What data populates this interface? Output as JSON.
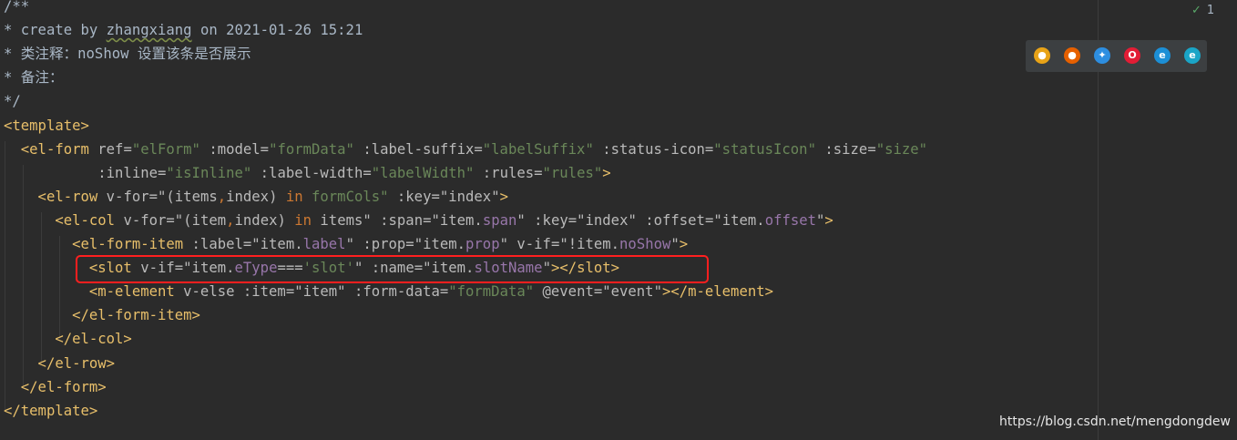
{
  "editor": {
    "lines": [
      [
        {
          "t": "/**",
          "c": "cm"
        }
      ],
      [
        {
          "t": "* create by ",
          "c": "cm"
        },
        {
          "t": "zhangxiang",
          "c": "cm cm-u"
        },
        {
          "t": " on 2021-01-26 15:21",
          "c": "cm"
        }
      ],
      [
        {
          "t": "* 类注释：noShow 设置该条是否展示",
          "c": "cm"
        }
      ],
      [
        {
          "t": "* 备注：",
          "c": "cm"
        }
      ],
      [
        {
          "t": "*/",
          "c": "cm"
        }
      ],
      [
        {
          "t": "<template>",
          "c": "tg"
        }
      ],
      [
        {
          "t": "  <el-form",
          "c": "tg"
        },
        {
          "t": " ref",
          "c": "at"
        },
        {
          "t": "=",
          "c": "at"
        },
        {
          "t": "\"elForm\"",
          "c": "st"
        },
        {
          "t": " :model",
          "c": "at"
        },
        {
          "t": "=",
          "c": "at"
        },
        {
          "t": "\"formData\"",
          "c": "st"
        },
        {
          "t": " :label-suffix",
          "c": "at"
        },
        {
          "t": "=",
          "c": "at"
        },
        {
          "t": "\"labelSuffix\"",
          "c": "st"
        },
        {
          "t": " :status-icon",
          "c": "at"
        },
        {
          "t": "=",
          "c": "at"
        },
        {
          "t": "\"statusIcon\"",
          "c": "st"
        },
        {
          "t": " :size",
          "c": "at"
        },
        {
          "t": "=",
          "c": "at"
        },
        {
          "t": "\"size\"",
          "c": "st"
        }
      ],
      [
        {
          "t": "           :inline",
          "c": "at"
        },
        {
          "t": "=",
          "c": "at"
        },
        {
          "t": "\"isInline\"",
          "c": "st"
        },
        {
          "t": " :label-width",
          "c": "at"
        },
        {
          "t": "=",
          "c": "at"
        },
        {
          "t": "\"labelWidth\"",
          "c": "st"
        },
        {
          "t": " :rules",
          "c": "at"
        },
        {
          "t": "=",
          "c": "at"
        },
        {
          "t": "\"rules\"",
          "c": "st"
        },
        {
          "t": ">",
          "c": "tg"
        }
      ],
      [
        {
          "t": "    <el-row",
          "c": "tg"
        },
        {
          "t": " v-for",
          "c": "at"
        },
        {
          "t": "=",
          "c": "at"
        },
        {
          "t": "\"(items",
          "c": "at"
        },
        {
          "t": ",",
          "c": "kw"
        },
        {
          "t": "index) ",
          "c": "at"
        },
        {
          "t": "in",
          "c": "kw"
        },
        {
          "t": " formCols\"",
          "c": "st"
        },
        {
          "t": " :key",
          "c": "at"
        },
        {
          "t": "=",
          "c": "at"
        },
        {
          "t": "\"index\"",
          "c": "at"
        },
        {
          "t": ">",
          "c": "tg"
        }
      ],
      [
        {
          "t": "      <el-col",
          "c": "tg"
        },
        {
          "t": " v-for",
          "c": "at"
        },
        {
          "t": "=",
          "c": "at"
        },
        {
          "t": "\"(item",
          "c": "at"
        },
        {
          "t": ",",
          "c": "kw"
        },
        {
          "t": "index) ",
          "c": "at"
        },
        {
          "t": "in",
          "c": "kw"
        },
        {
          "t": " items\"",
          "c": "at"
        },
        {
          "t": " :span",
          "c": "at"
        },
        {
          "t": "=",
          "c": "at"
        },
        {
          "t": "\"item.",
          "c": "at"
        },
        {
          "t": "span",
          "c": "pr"
        },
        {
          "t": "\"",
          "c": "at"
        },
        {
          "t": " :key",
          "c": "at"
        },
        {
          "t": "=",
          "c": "at"
        },
        {
          "t": "\"index\"",
          "c": "at"
        },
        {
          "t": " :offset",
          "c": "at"
        },
        {
          "t": "=",
          "c": "at"
        },
        {
          "t": "\"item.",
          "c": "at"
        },
        {
          "t": "offset",
          "c": "pr"
        },
        {
          "t": "\"",
          "c": "at"
        },
        {
          "t": ">",
          "c": "tg"
        }
      ],
      [
        {
          "t": "        <el-form-item",
          "c": "tg"
        },
        {
          "t": " :label",
          "c": "at"
        },
        {
          "t": "=",
          "c": "at"
        },
        {
          "t": "\"item.",
          "c": "at"
        },
        {
          "t": "label",
          "c": "pr"
        },
        {
          "t": "\"",
          "c": "at"
        },
        {
          "t": " :prop",
          "c": "at"
        },
        {
          "t": "=",
          "c": "at"
        },
        {
          "t": "\"item.",
          "c": "at"
        },
        {
          "t": "prop",
          "c": "pr"
        },
        {
          "t": "\"",
          "c": "at"
        },
        {
          "t": " v-if",
          "c": "at"
        },
        {
          "t": "=",
          "c": "at"
        },
        {
          "t": "\"!item.",
          "c": "at"
        },
        {
          "t": "noShow",
          "c": "pr"
        },
        {
          "t": "\"",
          "c": "at"
        },
        {
          "t": ">",
          "c": "tg"
        }
      ],
      [
        {
          "t": "          <slot",
          "c": "tg"
        },
        {
          "t": " v-if",
          "c": "at"
        },
        {
          "t": "=",
          "c": "at"
        },
        {
          "t": "\"item.",
          "c": "at"
        },
        {
          "t": "eType",
          "c": "pr"
        },
        {
          "t": "===",
          "c": "at"
        },
        {
          "t": "'slot'",
          "c": "sq"
        },
        {
          "t": "\"",
          "c": "at"
        },
        {
          "t": " :name",
          "c": "at"
        },
        {
          "t": "=",
          "c": "at"
        },
        {
          "t": "\"item.",
          "c": "at"
        },
        {
          "t": "slotName",
          "c": "pr"
        },
        {
          "t": "\"",
          "c": "at"
        },
        {
          "t": "></slot>",
          "c": "tg"
        }
      ],
      [
        {
          "t": "          <m-element",
          "c": "tg"
        },
        {
          "t": " v-else",
          "c": "at"
        },
        {
          "t": " :item",
          "c": "at"
        },
        {
          "t": "=",
          "c": "at"
        },
        {
          "t": "\"item\"",
          "c": "at"
        },
        {
          "t": " :form-data",
          "c": "at"
        },
        {
          "t": "=",
          "c": "at"
        },
        {
          "t": "\"formData\"",
          "c": "st"
        },
        {
          "t": " @event",
          "c": "at"
        },
        {
          "t": "=",
          "c": "at"
        },
        {
          "t": "\"event\"",
          "c": "at"
        },
        {
          "t": "></m-element>",
          "c": "tg"
        }
      ],
      [
        {
          "t": "        </el-form-item>",
          "c": "tg"
        }
      ],
      [
        {
          "t": "      </el-col>",
          "c": "tg"
        }
      ],
      [
        {
          "t": "    </el-row>",
          "c": "tg"
        }
      ],
      [
        {
          "t": "  </el-form>",
          "c": "tg"
        }
      ],
      [
        {
          "t": "</template>",
          "c": "tg"
        }
      ]
    ]
  },
  "inspection": {
    "count": "1",
    "check_icon": "check-icon"
  },
  "browsers": [
    {
      "name": "chrome-icon",
      "color": "#e8a317",
      "glyph": "●"
    },
    {
      "name": "firefox-icon",
      "color": "#e66000",
      "glyph": "●"
    },
    {
      "name": "safari-icon",
      "color": "#2d8ee0",
      "glyph": "✦"
    },
    {
      "name": "opera-icon",
      "color": "#e21d35",
      "glyph": "O"
    },
    {
      "name": "ie-icon",
      "color": "#1c8fd6",
      "glyph": "e"
    },
    {
      "name": "edge-icon",
      "color": "#1aa5c7",
      "glyph": "e"
    }
  ],
  "watermark": "https://blog.csdn.net/mengdongdew",
  "colors": {
    "highlight": "#ff1f1f",
    "background": "#2b2b2b"
  }
}
